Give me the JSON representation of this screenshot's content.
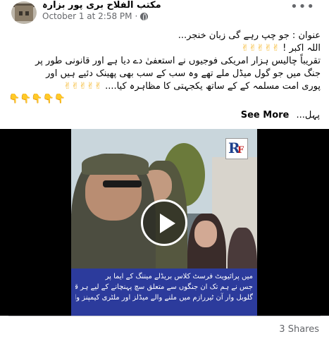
{
  "header": {
    "page_name": "مکتب الفلاح بری پور بزارہ",
    "timestamp": "October 1 at 2:58 PM",
    "privacy_icon": "globe-icon",
    "more_icon": "more-horizontal-icon"
  },
  "post": {
    "lines": [
      "عنوان : جو چپ رہے گی زبان خنجر...",
      "اللہ اکبر !",
      "تقریباً چالیس ہزار امریکی فوجیوں نے استعفیٰ دے دیا ہے اور قانونی طور پر",
      "جنگ میں جو گول میڈل ملے تھے وہ سب کے سب بھی پھینک دئیے ہیں اور",
      "پوری امت مسلمہ کے کے ساتھ یکجہتی کا مظاہرہ کیا...."
    ],
    "emoji_hands_up": "✌✌✌✌✌",
    "emoji_hands_end": "✌✌✌✌✌",
    "emoji_pointing": "👇👇👇👇👇",
    "trailing_text": "پہل...",
    "see_more_label": "See More"
  },
  "video": {
    "play_icon": "play-icon",
    "logo_text_r": "R",
    "logo_text_f": "F",
    "caption_lines": [
      "میں پرائیویٹ فرسٹ کلاس بریڈلے میننگ کے ایما پر",
      "جس نے ہم تک ان جنگوں سے متعلق سچ پہنچانے کے لیے ہر قسم کی قربانی دی",
      "گلوبل وار آن ٹیررازم میں ملنے والے میڈلز اور ملٹری کیمپنز واپس کر رہا ہوں۔"
    ]
  },
  "footer": {
    "shares_label": "3 Shares"
  }
}
